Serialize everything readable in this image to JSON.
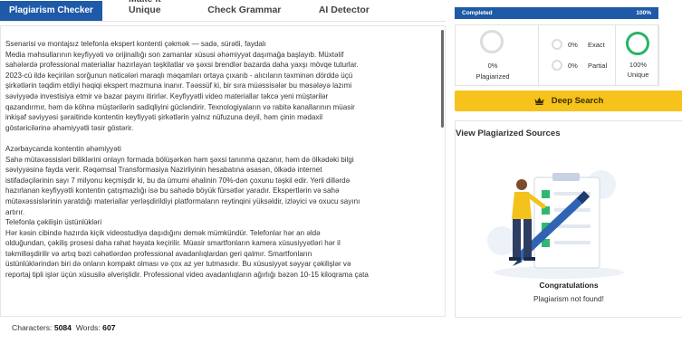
{
  "tabs": [
    {
      "label": "Plagiarism Checker"
    },
    {
      "label": "Make it Unique"
    },
    {
      "label": "Check Grammar"
    },
    {
      "label": "AI Detector"
    }
  ],
  "editor": {
    "text": "Ssenarisi və montajsız telefonla ekspert kontenti çəkmək — sadə, sürətli, faydalı\nMedia məhsullarının keyfiyyəti və orijinallığı son zamanlar xüsusi əhəmiyyət daşımağa başlayıb. Müxtəlif\nsahələrdə professional materiallar hazırlayan təşkilatlar və şəxsi brendlər bazarda daha yaxşı mövqe tuturlar.\n2023-cü ildə keçirilən sorğunun nəticələri maraqlı məqamları ortaya çıxarıb - alıcıların təxminən dörddə üçü\nşirkətlərin təqdim etdiyi həqiqi ekspert məzmuna inanır. Təəssüf ki, bir sıra müəssisələr bu məsələyə lazımi\nsəviyyədə investisiya etmir və bazar payını itirirlər. Keyfiyyətli video materiallar təkcə yeni müştərilər\nqazandırmır, həm də köhnə müştərilərin sadiqliyini gücləndirir. Texnologiyaların və rabitə kanallarının müasir\ninkişaf səviyyəsi şəraitində kontentin keyfiyyəti şirkətlərin yalnız nüfuzuna deyil, həm çinin mədaxil\ngöstəricilərinə əhəmiyyətli təsir göstərir.\n\nAzərbaycanda kontentin əhəmiyyəti\nSahə mütəxəssisləri biliklərini onlayn formada bölüşərkən həm şəxsi tanınma qazanır, həm də ölkədəki bilgi\nsəviyyəsinə fayda verir. Rəqəmsal Transformasiya Nazirliyinin hesabatına əsasən, ölkədə internet\nistifadəçilərinin sayı 7 milyonu keçmişdir ki, bu da ümumi əhalinin 70%-dən çoxunu təşkil edir. Yerli dillərdə\nhazırlanan keyfiyyətli kontentin çatışmazlığı isə bu sahədə böyük fürsətlər yaradır. Ekspertlərin və sahə\nmütəxəssislərinin yaratdığı materiallar yerləşdirildiyi platformaların reytinqini yüksəldir, izləyici və oxucu sayını\nartırır.\nTelefonla çəkilişin üstünlükləri\nHər kəsin cibində hazırda kiçik videostudiya daşıdığını demək mümkündür. Telefonlar hər an əldə\nolduğundan, çəkiliş prosesi daha rahat həyata keçirilir. Müasir smartfonların kamera xüsusiyyətləri hər il\ntəkmilləşdirilir və artıq bəzi cəhətlərdən professional avadanlıqlardan geri qalmır. Smartfonların\nüstünlüklərindən biri də onların kompakt olması və çox az yer tutmasıdır. Bu xüsusiyyət səyyar çəkilişlər və\nreportaj tipli işlər üçün xüsusilə əlverişlidir. Professional video avadanlıqların ağırlığı bəzən 10-15 kiloqrama çata"
  },
  "counts": {
    "characters_label": "Characters:",
    "characters_value": "5084",
    "words_label": "Words:",
    "words_value": "607"
  },
  "progress": {
    "label": "Completed",
    "percent_text": "100%",
    "percent": 100
  },
  "stats": {
    "plagiarized": {
      "value": "0%",
      "label": "Plagiarized"
    },
    "exact": {
      "value": "0%",
      "label": "Exact"
    },
    "partial": {
      "value": "0%",
      "label": "Partial"
    },
    "unique": {
      "value": "100%",
      "label": "Unique"
    }
  },
  "deep_search": {
    "label": "Deep Search",
    "icon": "crown-icon"
  },
  "sources": {
    "title": "View Plagiarized Sources",
    "congrats": "Congratulations",
    "message": "Plagiarism not found!"
  },
  "colors": {
    "primary": "#1e5aa8",
    "accent": "#f6c21c",
    "success": "#28b463"
  }
}
